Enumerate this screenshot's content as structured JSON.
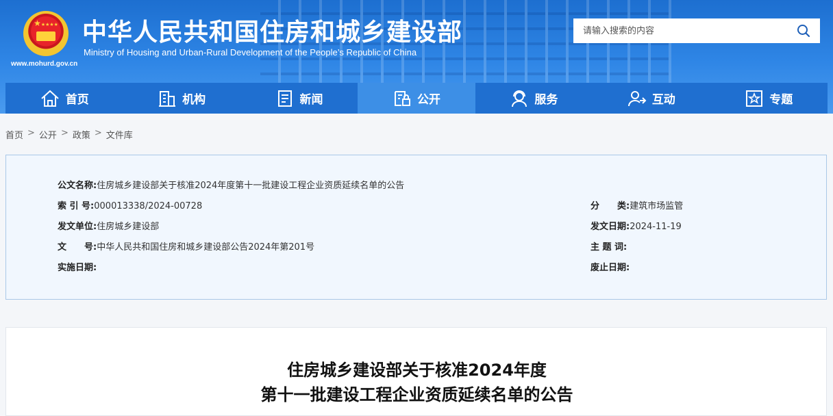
{
  "header": {
    "title_cn": "中华人民共和国住房和城乡建设部",
    "title_en": "Ministry of Housing and Urban-Rural Development of the People’s Republic of China",
    "site_url": "www.mohurd.gov.cn",
    "emblem_icon": "national-emblem-icon",
    "search": {
      "placeholder": "请输入搜索的内容",
      "icon": "search-icon"
    }
  },
  "nav": {
    "items": [
      {
        "label": "首页",
        "icon": "home-icon"
      },
      {
        "label": "机构",
        "icon": "building-icon"
      },
      {
        "label": "新闻",
        "icon": "news-icon"
      },
      {
        "label": "公开",
        "icon": "disclosure-icon",
        "active": true
      },
      {
        "label": "服务",
        "icon": "service-icon"
      },
      {
        "label": "互动",
        "icon": "interaction-icon"
      },
      {
        "label": "专题",
        "icon": "topic-star-icon"
      }
    ]
  },
  "breadcrumb": [
    "首页",
    "公开",
    "政策",
    "文件库"
  ],
  "breadcrumb_sep": ">",
  "meta": {
    "doc_name_label": "公文名称:",
    "doc_name": "住房城乡建设部关于核准2024年度第十一批建设工程企业资质延续名单的公告",
    "index_label": "索 引 号:",
    "index": "000013338/2024-00728",
    "category_label": "分　　类:",
    "category": "建筑市场监管",
    "issuer_label": "发文单位:",
    "issuer": "住房城乡建设部",
    "issue_date_label": "发文日期:",
    "issue_date": "2024-11-19",
    "doc_no_label": "文　　号:",
    "doc_no": "中华人民共和国住房和城乡建设部公告2024年第201号",
    "subject_label": "主 题 词:",
    "subject": "",
    "effective_label": "实施日期:",
    "effective": "",
    "repeal_label": "废止日期:",
    "repeal": ""
  },
  "document": {
    "title_line1": "住房城乡建设部关于核准2024年度",
    "title_line2": "第十一批建设工程企业资质延续名单的公告"
  },
  "colors": {
    "header_blue": "#1d6fd0",
    "nav_active": "#3d8fe6",
    "meta_bg": "#f1f7fe",
    "meta_border": "#a9c8e8"
  }
}
